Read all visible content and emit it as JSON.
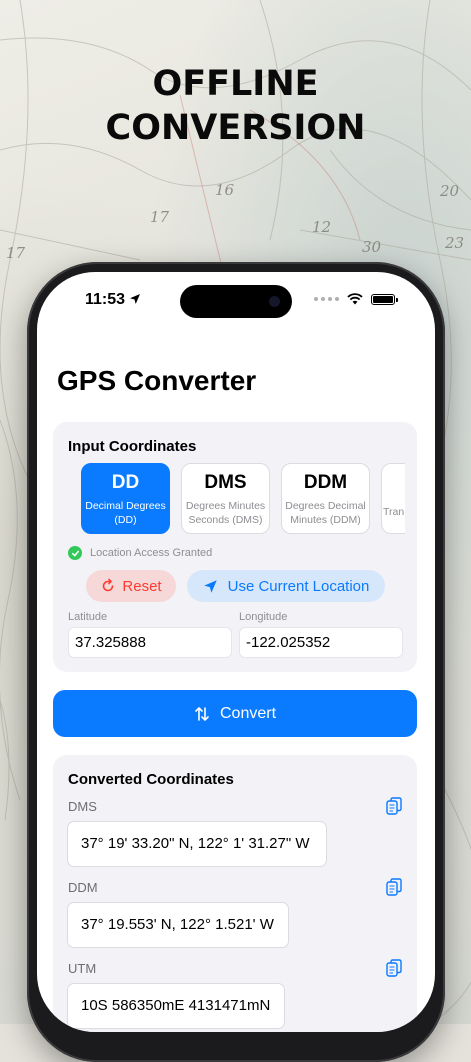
{
  "headline": {
    "line1": "OFFLINE",
    "line2": "CONVERSION"
  },
  "background_map_numbers": [
    "17",
    "16",
    "12",
    "30",
    "23",
    "17",
    "20"
  ],
  "status_bar": {
    "time": "11:53"
  },
  "app": {
    "title": "GPS Converter",
    "input": {
      "section_title": "Input Coordinates",
      "formats": [
        {
          "abbr": "DD",
          "name": "Decimal Degrees (DD)",
          "selected": true
        },
        {
          "abbr": "DMS",
          "name": "Degrees Minutes Seconds (DMS)",
          "selected": false
        },
        {
          "abbr": "DDM",
          "name": "Degrees Decimal Minutes (DDM)",
          "selected": false
        },
        {
          "abbr": "",
          "name": "Tran",
          "selected": false
        }
      ],
      "permission_status": "Location Access Granted",
      "reset_label": "Reset",
      "use_location_label": "Use Current Location",
      "latitude_label": "Latitude",
      "latitude_value": "37.325888",
      "longitude_label": "Longitude",
      "longitude_value": "-122.025352"
    },
    "convert_label": "Convert",
    "results": {
      "section_title": "Converted Coordinates",
      "items": [
        {
          "label": "DMS",
          "value": "37° 19' 33.20\" N, 122° 1' 31.27\" W"
        },
        {
          "label": "DDM",
          "value": "37° 19.553' N, 122° 1.521' W"
        },
        {
          "label": "UTM",
          "value": "10S 586350mE 4131471mN"
        }
      ]
    }
  },
  "colors": {
    "accent": "#0a7aff",
    "danger": "#ff3b30",
    "success": "#34c759"
  }
}
